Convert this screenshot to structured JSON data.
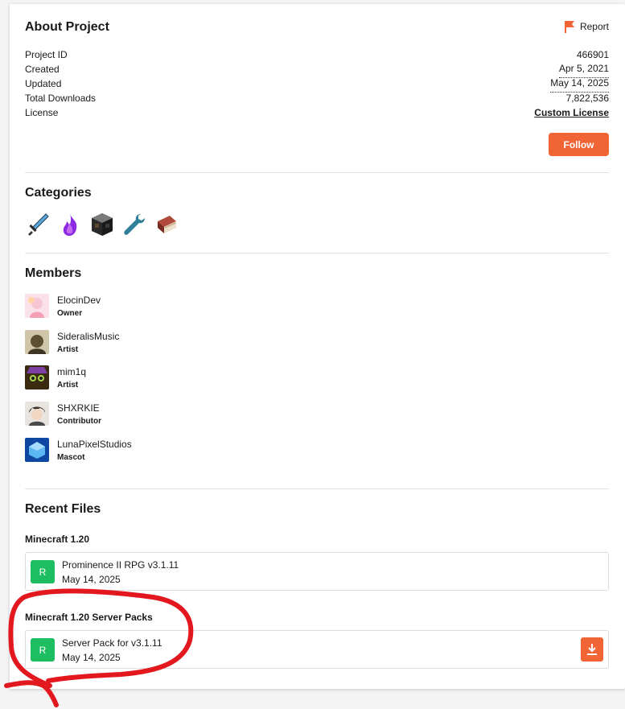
{
  "about": {
    "title": "About Project",
    "report_label": "Report",
    "rows": [
      {
        "label": "Project ID",
        "value": "466901"
      },
      {
        "label": "Created",
        "value": "Apr 5, 2021"
      },
      {
        "label": "Updated",
        "value": "May 14, 2025"
      },
      {
        "label": "Total Downloads",
        "value": "7,822,536"
      },
      {
        "label": "License",
        "value": "Custom License"
      }
    ],
    "follow_label": "Follow"
  },
  "categories": {
    "title": "Categories",
    "icons": [
      "sword-icon",
      "purple-flame-icon",
      "crafting-block-icon",
      "wrench-icon",
      "book-icon"
    ]
  },
  "members": {
    "title": "Members",
    "items": [
      {
        "name": "ElocinDev",
        "role": "Owner"
      },
      {
        "name": "SideralisMusic",
        "role": "Artist"
      },
      {
        "name": "mim1q",
        "role": "Artist"
      },
      {
        "name": "SHXRKIE",
        "role": "Contributor"
      },
      {
        "name": "LunaPixelStudios",
        "role": "Mascot"
      }
    ]
  },
  "recent_files": {
    "title": "Recent Files",
    "groups": [
      {
        "title": "Minecraft 1.20",
        "file": {
          "badge": "R",
          "name": "Prominence II RPG v3.1.11",
          "date": "May 14, 2025"
        }
      },
      {
        "title": "Minecraft 1.20 Server Packs",
        "file": {
          "badge": "R",
          "name": "Server Pack for v3.1.11",
          "date": "May 14, 2025"
        }
      }
    ]
  },
  "colors": {
    "accent": "#f16436",
    "release_badge": "#1dbd62",
    "annotation": "#e3181e"
  }
}
